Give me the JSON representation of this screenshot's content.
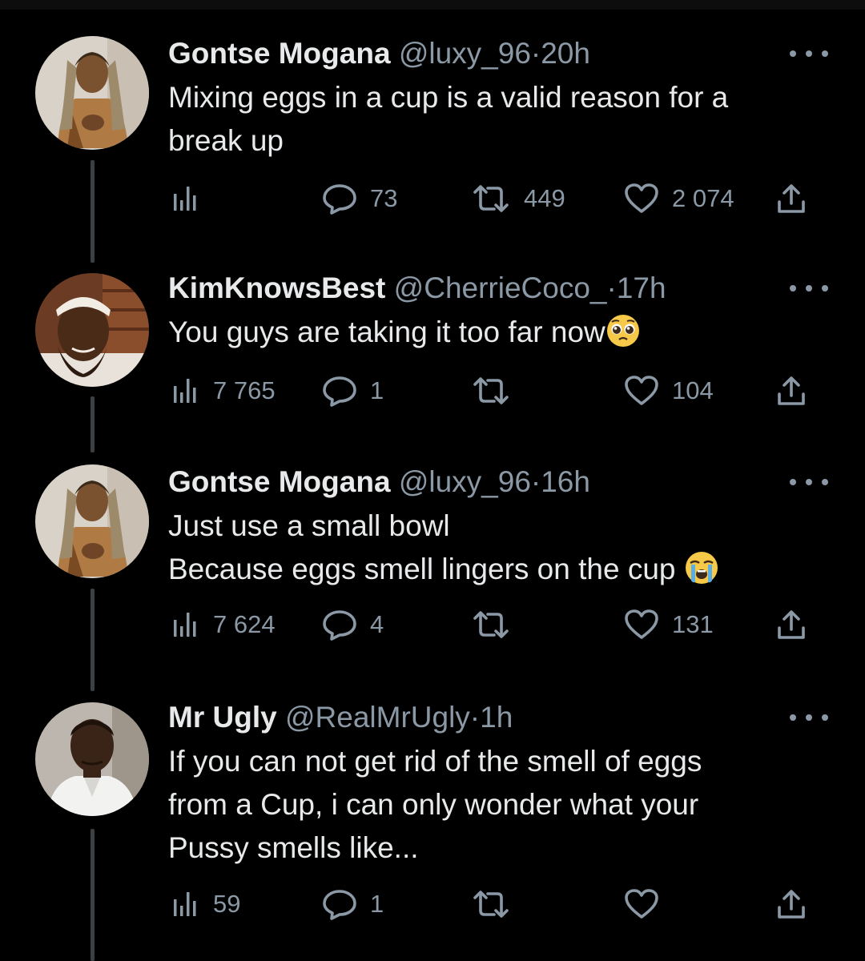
{
  "colors": {
    "background": "#000000",
    "text": "#e7e9ea",
    "muted": "#8b98a5",
    "thread_line": "#3d4043"
  },
  "tweets": [
    {
      "name": "Gontse Mogana",
      "handle": "@luxy_96",
      "separator": "·",
      "time": "20h",
      "lines": [
        "Mixing eggs in a cup is a valid reason for a",
        "break up"
      ],
      "emoji": null,
      "avatar_icon": "avatar-photo-braids",
      "views": "",
      "replies": "73",
      "retweets": "449",
      "likes": "2 074"
    },
    {
      "name": "KimKnowsBest",
      "handle": "@CherrieCoco_",
      "separator": "·",
      "time": "17h",
      "lines": [
        "You guys are taking it too far now"
      ],
      "emoji": "pleading-face-emoji",
      "avatar_icon": "avatar-photo-headband",
      "views": "7 765",
      "replies": "1",
      "retweets": "",
      "likes": "104"
    },
    {
      "name": "Gontse Mogana",
      "handle": "@luxy_96",
      "separator": "·",
      "time": "16h",
      "lines": [
        "Just use a small bowl",
        "Because eggs smell lingers on the cup "
      ],
      "emoji": "loudly-crying-face-emoji",
      "avatar_icon": "avatar-photo-braids",
      "views": "7 624",
      "replies": "4",
      "retweets": "",
      "likes": "131"
    },
    {
      "name": "Mr Ugly",
      "handle": "@RealMrUgly",
      "separator": "·",
      "time": "1h",
      "lines": [
        "If you can not get rid of the smell of eggs",
        "from a Cup, i can only wonder what your",
        "Pussy smells like..."
      ],
      "emoji": null,
      "avatar_icon": "avatar-photo-man-white-shirt",
      "views": "59",
      "replies": "1",
      "retweets": "",
      "likes": ""
    }
  ]
}
